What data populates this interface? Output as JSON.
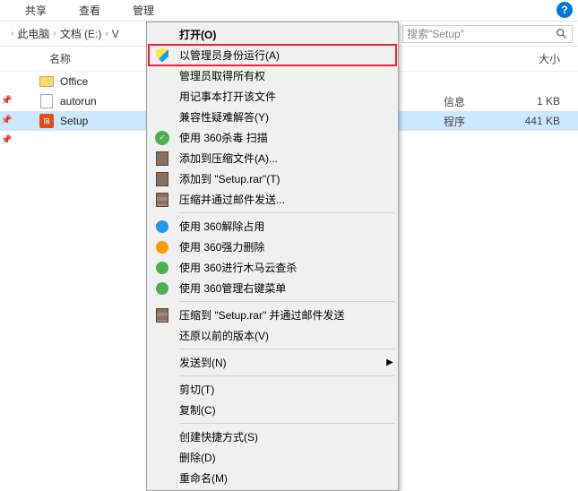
{
  "tabs": {
    "share": "共享",
    "view": "查看",
    "manage": "管理"
  },
  "breadcrumb": {
    "pc": "此电脑",
    "docs": "文档 (E:)",
    "folder": "V"
  },
  "search": {
    "placeholder": "搜索\"Setup\""
  },
  "columns": {
    "name": "名称",
    "size": "大小"
  },
  "files": {
    "office": {
      "name": "Office"
    },
    "autorun": {
      "name": "autorun"
    },
    "setup": {
      "name": "Setup",
      "type_partial": "程序"
    }
  },
  "info_partial": "信息",
  "sizes": {
    "kb1": "1 KB",
    "kb441": "441 KB"
  },
  "menu": {
    "open": "打开(O)",
    "runas": "以管理员身份运行(A)",
    "takeown": "管理员取得所有权",
    "notepad": "用记事本打开该文件",
    "troubleshoot": "兼容性疑难解答(Y)",
    "scan360": "使用 360杀毒 扫描",
    "addarchive": "添加到压缩文件(A)...",
    "addsetup": "添加到 \"Setup.rar\"(T)",
    "zipmail": "压缩并通过邮件发送...",
    "unlock360": "使用 360解除占用",
    "forcedel360": "使用 360强力删除",
    "trojan360": "使用 360进行木马云查杀",
    "rclick360": "使用 360管理右键菜单",
    "zipsetupmail": "压缩到 \"Setup.rar\" 并通过邮件发送",
    "restore": "还原以前的版本(V)",
    "sendto": "发送到(N)",
    "cut": "剪切(T)",
    "copy": "复制(C)",
    "shortcut": "创建快捷方式(S)",
    "delete": "删除(D)",
    "rename": "重命名(M)"
  }
}
